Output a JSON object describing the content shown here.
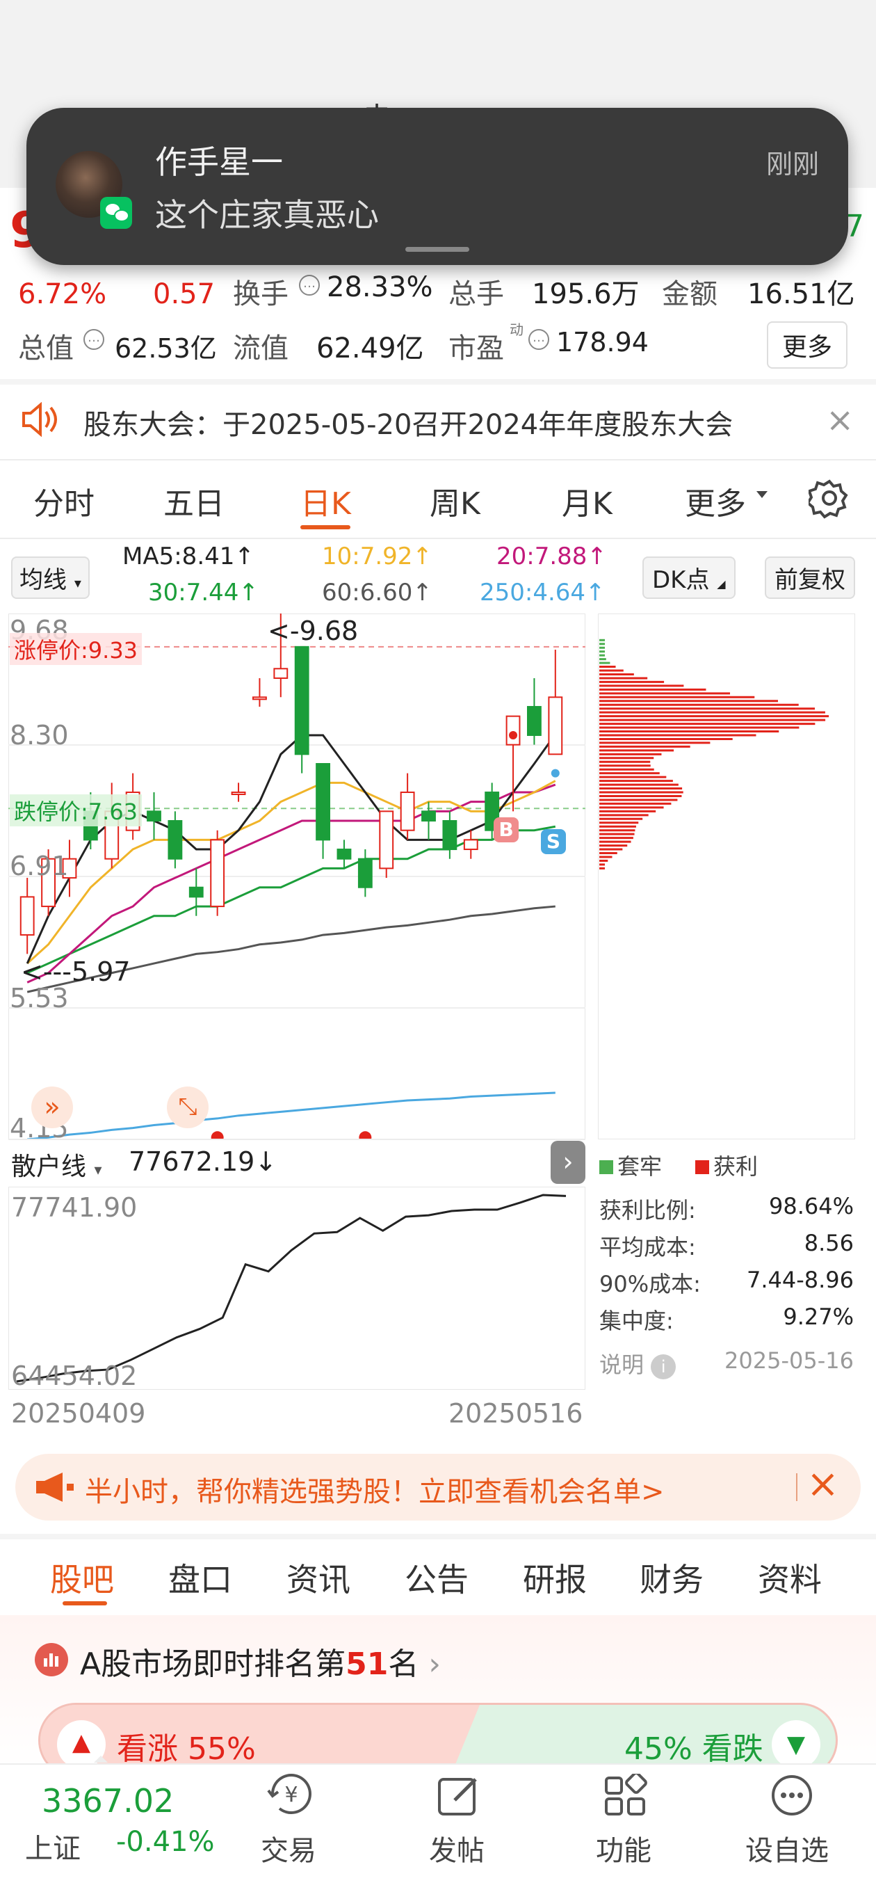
{
  "header": {
    "title_partial": "赤",
    "price_partial": "9",
    "right_partial": "7"
  },
  "notification": {
    "sender": "作手星一",
    "message": "这个庄家真恶心",
    "time": "刚刚"
  },
  "quote": {
    "change_pct": "6.72%",
    "change_amt": "0.57",
    "turnover_label": "换手",
    "turnover": "28.33%",
    "volume_label": "总手",
    "volume": "195.6万",
    "amount_label": "金额",
    "amount": "16.51亿",
    "mktcap_label": "总值",
    "mktcap": "62.53亿",
    "float_label": "流值",
    "float": "62.49亿",
    "pe_label": "市盈",
    "pe_sup": "动",
    "pe": "178.94",
    "more": "更多"
  },
  "announce": {
    "text": "股东大会：于2025-05-20召开2024年年度股东大会"
  },
  "chart_tabs": [
    "分时",
    "五日",
    "日K",
    "周K",
    "月K",
    "更多"
  ],
  "ma": {
    "selector": "均线",
    "ma5": "MA5:8.41↑",
    "ma10": "10:7.92↑",
    "ma20": "20:7.88↑",
    "ma30": "30:7.44↑",
    "ma60": "60:6.60↑",
    "ma250": "250:4.64↑",
    "dk": "DK点",
    "fq": "前复权"
  },
  "kchart": {
    "y_top": "9.68",
    "y_2": "8.30",
    "y_3": "6.91",
    "y_4": "5.53",
    "y_bot": "4.15",
    "limit_up": "涨停价:9.33",
    "limit_down": "跌停价:7.63",
    "high_mark": "9.68",
    "low_mark": "5.97",
    "buy": "B",
    "sell": "S"
  },
  "chart_data": {
    "type": "candlestick",
    "ylim": [
      4.15,
      9.68
    ],
    "candles": [
      [
        6.3,
        6.7,
        6.1,
        6.9
      ],
      [
        6.6,
        7.1,
        6.5,
        7.2
      ],
      [
        6.9,
        7.1,
        6.7,
        7.3
      ],
      [
        7.6,
        7.3,
        7.2,
        7.8
      ],
      [
        7.1,
        7.6,
        7.0,
        7.9
      ],
      [
        7.4,
        7.8,
        7.3,
        8.0
      ],
      [
        7.6,
        7.5,
        7.3,
        7.8
      ],
      [
        7.5,
        7.1,
        7.0,
        7.6
      ],
      [
        6.8,
        6.7,
        6.5,
        7.0
      ],
      [
        6.6,
        7.3,
        6.5,
        7.4
      ],
      [
        7.8,
        7.8,
        7.7,
        7.9
      ],
      [
        8.8,
        8.8,
        8.7,
        9.0
      ],
      [
        9.0,
        9.1,
        8.8,
        9.7
      ],
      [
        9.33,
        8.2,
        8.0,
        9.33
      ],
      [
        8.1,
        7.3,
        7.1,
        8.1
      ],
      [
        7.2,
        7.1,
        7.0,
        7.3
      ],
      [
        7.1,
        6.8,
        6.7,
        7.2
      ],
      [
        7.0,
        7.6,
        6.9,
        7.6
      ],
      [
        7.4,
        7.8,
        7.3,
        8.0
      ],
      [
        7.6,
        7.5,
        7.3,
        7.7
      ],
      [
        7.5,
        7.2,
        7.1,
        7.6
      ],
      [
        7.2,
        7.3,
        7.1,
        7.4
      ],
      [
        7.8,
        7.4,
        7.3,
        7.9
      ],
      [
        8.3,
        8.6,
        7.6,
        8.6
      ],
      [
        8.7,
        8.4,
        8.3,
        9.0
      ],
      [
        8.2,
        8.8,
        8.2,
        9.3
      ]
    ],
    "ma5": [
      6.0,
      6.5,
      6.9,
      7.3,
      7.5,
      7.6,
      7.5,
      7.4,
      7.2,
      7.2,
      7.4,
      7.7,
      8.2,
      8.4,
      8.4,
      8.1,
      7.8,
      7.5,
      7.3,
      7.3,
      7.3,
      7.4,
      7.5,
      7.8,
      8.1,
      8.41
    ],
    "ma10": [
      6.0,
      6.2,
      6.5,
      6.8,
      7.0,
      7.2,
      7.3,
      7.3,
      7.3,
      7.3,
      7.4,
      7.5,
      7.7,
      7.8,
      7.9,
      7.9,
      7.8,
      7.7,
      7.6,
      7.7,
      7.7,
      7.6,
      7.6,
      7.7,
      7.8,
      7.92
    ],
    "ma20": [
      5.8,
      5.9,
      6.1,
      6.3,
      6.5,
      6.6,
      6.8,
      6.9,
      7.0,
      7.1,
      7.2,
      7.3,
      7.4,
      7.5,
      7.5,
      7.5,
      7.5,
      7.5,
      7.5,
      7.6,
      7.6,
      7.7,
      7.7,
      7.8,
      7.8,
      7.88
    ],
    "ma30": [
      5.9,
      6.0,
      6.1,
      6.2,
      6.3,
      6.4,
      6.5,
      6.5,
      6.6,
      6.6,
      6.7,
      6.8,
      6.8,
      6.9,
      7.0,
      7.0,
      7.1,
      7.1,
      7.1,
      7.2,
      7.2,
      7.3,
      7.3,
      7.4,
      7.4,
      7.44
    ],
    "ma60": [
      5.7,
      5.75,
      5.8,
      5.85,
      5.9,
      5.95,
      6.0,
      6.05,
      6.1,
      6.12,
      6.15,
      6.2,
      6.22,
      6.25,
      6.3,
      6.32,
      6.35,
      6.38,
      6.4,
      6.43,
      6.46,
      6.5,
      6.52,
      6.55,
      6.58,
      6.6
    ],
    "ma250": [
      4.15,
      4.17,
      4.2,
      4.22,
      4.25,
      4.27,
      4.3,
      4.32,
      4.35,
      4.37,
      4.4,
      4.42,
      4.44,
      4.46,
      4.48,
      4.5,
      4.52,
      4.54,
      4.56,
      4.57,
      4.58,
      4.6,
      4.61,
      4.62,
      4.63,
      4.64
    ]
  },
  "retail": {
    "label": "散户线",
    "value": "77672.19↓",
    "top": "77741.90",
    "bottom": "64454.02",
    "date_start": "20250409",
    "date_end": "20250516",
    "series": [
      64454,
      64700,
      65000,
      65200,
      65300,
      66000,
      66800,
      67600,
      68200,
      69000,
      72800,
      72300,
      73800,
      75000,
      75100,
      76100,
      75200,
      76200,
      76300,
      76600,
      76700,
      76700,
      77200,
      77741.9,
      77672.19
    ]
  },
  "chip": {
    "legend_trapped": "套牢",
    "legend_profit": "获利",
    "rows": [
      {
        "k": "获利比例:",
        "v": "98.64%"
      },
      {
        "k": "平均成本:",
        "v": "8.56"
      },
      {
        "k": "90%成本:",
        "v": "7.44-8.96"
      },
      {
        "k": "集中度:",
        "v": "9.27%"
      }
    ],
    "note": "说明",
    "date": "2025-05-16"
  },
  "promo": {
    "text": "半小时，帮你精选强势股！立即查看机会名单>"
  },
  "tabs2": [
    "股吧",
    "盘口",
    "资讯",
    "公告",
    "研报",
    "财务",
    "资料"
  ],
  "rank": {
    "prefix": "A股市场即时排名第",
    "num": "51",
    "suffix": "名"
  },
  "vote": {
    "up": "看涨 55%",
    "down": "45% 看跌"
  },
  "bottom": {
    "index_value": "3367.02",
    "index_name": "上证",
    "index_change": "-0.41%",
    "nav": [
      "交易",
      "发帖",
      "功能",
      "设自选"
    ]
  },
  "colors": {
    "up": "#e2231a",
    "down": "#1b9e3a",
    "accent": "#e8591c"
  }
}
